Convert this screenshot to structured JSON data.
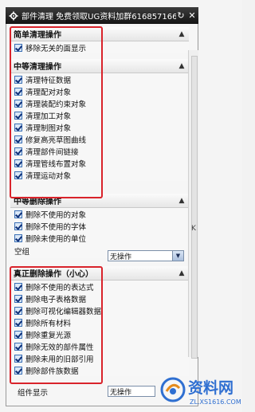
{
  "window": {
    "title": "部件清理 免费领取UG资料加群616857166",
    "gear_icon": "gear-icon",
    "reset_icon": "reset-icon",
    "close_icon": "close-icon"
  },
  "sections": [
    {
      "header": "简单清理操作",
      "items": [
        {
          "label": "移除无关的面显示",
          "checked": true
        }
      ]
    },
    {
      "header": "中等清理操作",
      "items": [
        {
          "label": "清理特征数据",
          "checked": true
        },
        {
          "label": "清理配对对象",
          "checked": true
        },
        {
          "label": "清理装配约束对象",
          "checked": true
        },
        {
          "label": "清理加工对象",
          "checked": true
        },
        {
          "label": "清理制图对象",
          "checked": true
        },
        {
          "label": "修复高亮草图曲线",
          "checked": true
        },
        {
          "label": "清理部件间链接",
          "checked": true
        },
        {
          "label": "清理管线布置对象",
          "checked": true
        },
        {
          "label": "清理运动对象",
          "checked": true
        }
      ]
    },
    {
      "header": "中等删除操作",
      "items": [
        {
          "label": "删除不使用的对象",
          "checked": true
        },
        {
          "label": "删除不使用的字体",
          "checked": true
        },
        {
          "label": "删除未使用的单位",
          "checked": true
        }
      ],
      "dropdown": {
        "label": "空组",
        "value": "无操作"
      }
    },
    {
      "header": "真正删除操作（小心）",
      "items": [
        {
          "label": "删除不使用的表达式",
          "checked": true
        },
        {
          "label": "删除电子表格数据",
          "checked": true
        },
        {
          "label": "删除可视化编辑器数据",
          "checked": true
        },
        {
          "label": "删除所有材料",
          "checked": true
        },
        {
          "label": "删除重复光源",
          "checked": true
        },
        {
          "label": "删除无效的部件属性",
          "checked": true
        },
        {
          "label": "删除未用的旧部引用",
          "checked": true
        },
        {
          "label": "删除部件族数据",
          "checked": true
        }
      ]
    }
  ],
  "footer": {
    "label": "组件显示",
    "value": "无操作"
  },
  "side_mark": "K",
  "watermark": {
    "text": "资料网",
    "url": "ZL.XS1616.COM"
  },
  "colors": {
    "accent_red": "#d9232b",
    "title_bar": "#1e1e1e",
    "checkbox": "#dbe8f7",
    "watermark": "#2f6fd1"
  }
}
